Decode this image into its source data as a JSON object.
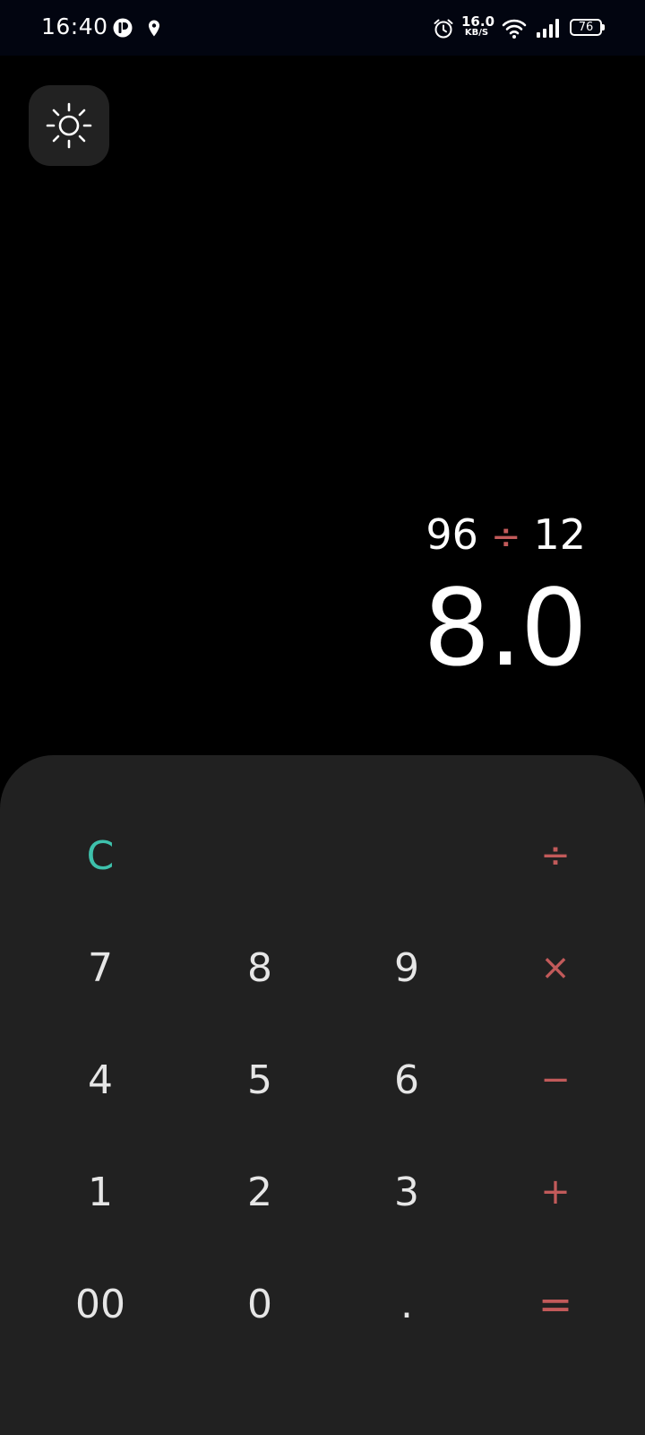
{
  "status_bar": {
    "time": "16:40",
    "network_speed_value": "16.0",
    "network_speed_unit": "KB/S",
    "battery_level": "76",
    "icons": [
      "app-notification-icon",
      "location-icon",
      "alarm-icon",
      "wifi-icon",
      "cellular-signal-icon",
      "battery-icon"
    ]
  },
  "theme_toggle": {
    "icon": "sun-icon"
  },
  "display": {
    "operand_1": "96",
    "operator": "÷",
    "operand_2": "12",
    "result": "8.0"
  },
  "keypad": {
    "clear": "C",
    "divide": "÷",
    "multiply": "×",
    "subtract": "−",
    "add": "+",
    "equals": "=",
    "seven": "7",
    "eight": "8",
    "nine": "9",
    "four": "4",
    "five": "5",
    "six": "6",
    "one": "1",
    "two": "2",
    "three": "3",
    "double_zero": "00",
    "zero": "0",
    "decimal": "."
  },
  "colors": {
    "background": "#000000",
    "keypad_background": "#212121",
    "operator_accent": "#c25a5a",
    "clear_accent": "#3ec1ac",
    "digit_text": "#e6e6e6"
  }
}
